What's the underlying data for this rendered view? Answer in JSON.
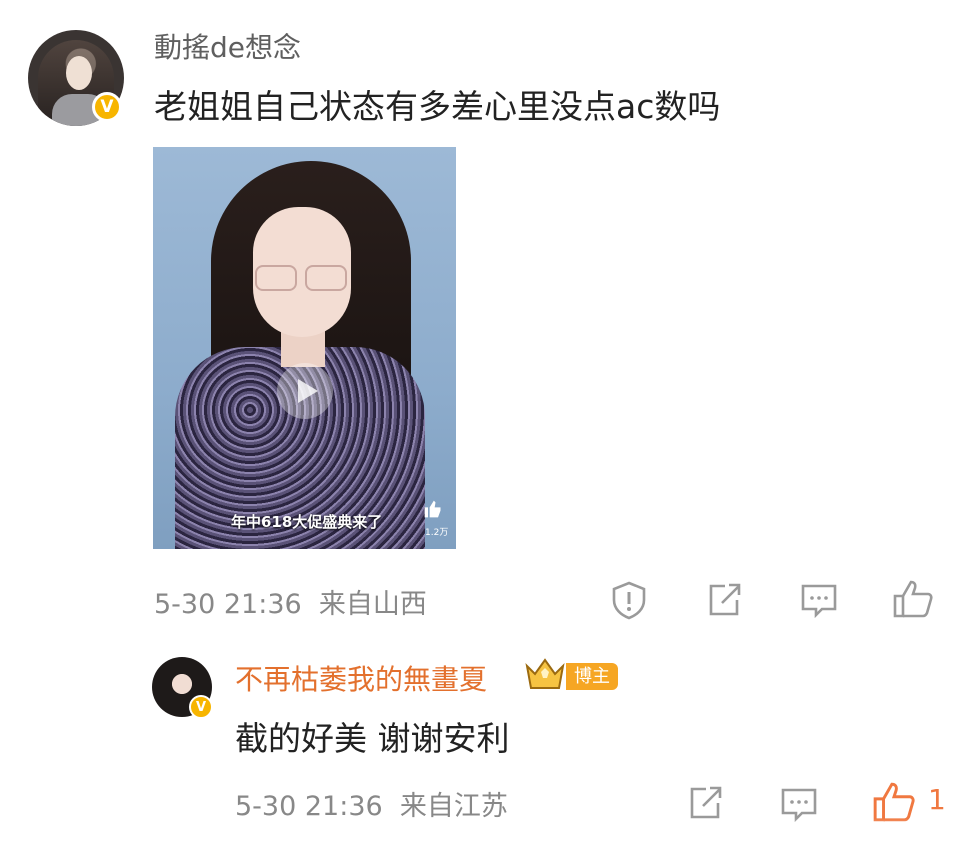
{
  "main_comment": {
    "username": "動搖de想念",
    "verified_badge": "V",
    "text": "老姐姐自己状态有多差心里没点ac数吗",
    "image": {
      "caption": "年中618大促盛典来了",
      "like_count": "1.2万"
    },
    "date": "5-30 21:36",
    "source": "来自山西",
    "actions": [
      "report-icon",
      "repost-icon",
      "comment-icon",
      "like-icon"
    ]
  },
  "reply": {
    "username": "不再枯萎我的無畫夏",
    "verified_badge": "V",
    "host_badge": "博主",
    "text": "截的好美 谢谢安利",
    "date": "5-30 21:36",
    "source": "来自江苏",
    "like_count": "1",
    "actions": [
      "repost-icon",
      "comment-icon",
      "like-icon"
    ]
  },
  "colors": {
    "username_main": "#5f5f5f",
    "username_reply": "#e3702d",
    "badge": "#f7b500",
    "host_badge": "#f6a623",
    "meta": "#888888",
    "like_active": "#f07840"
  }
}
